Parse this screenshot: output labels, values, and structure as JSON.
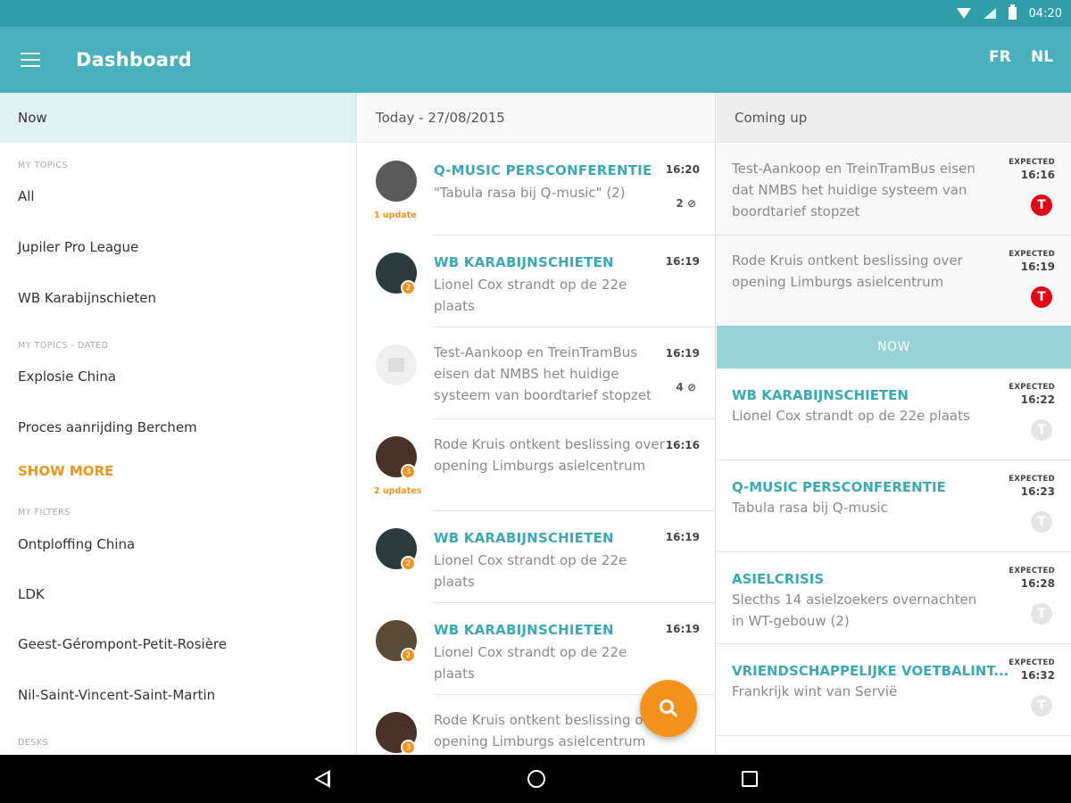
{
  "status_bar": {
    "time": "04:20"
  },
  "app_bar": {
    "title": "Dashboard",
    "lang_fr": "FR",
    "lang_nl": "NL"
  },
  "sidebar": {
    "now_label": "Now",
    "sections": {
      "my_topics": "MY TOPICS",
      "my_topics_dated": "MY TOPICS - DATED",
      "my_filters": "MY FILTERS",
      "desks": "DESKS"
    },
    "topics": [
      "All",
      "Jupiler Pro League",
      "WB Karabijnschieten"
    ],
    "dated_topics": [
      "Explosie China",
      "Proces aanrijding Berchem"
    ],
    "show_more": "SHOW MORE",
    "filters": [
      "Ontploffing China",
      "LDK",
      "Geest-Gérompont-Petit-Rosière",
      "Nil-Saint-Vincent-Saint-Martin"
    ]
  },
  "feed": {
    "header": "Today - 27/08/2015",
    "items": [
      {
        "title": "Q-MUSIC PERSCONFERENTIE",
        "text": "\"Tabula rasa bij Q-music\" (2)",
        "time": "16:20",
        "attach": "2",
        "updates": "1 update",
        "badge": "",
        "avatar_color": "#5a5a5a"
      },
      {
        "title": "WB KARABIJNSCHIETEN",
        "text": "Lionel Cox strandt op de 22e plaats",
        "time": "16:19",
        "attach": "",
        "updates": "",
        "badge": "2",
        "avatar_color": "#2b3a3c"
      },
      {
        "title": "",
        "text": "Test-Aankoop en TreinTramBus eisen dat NMBS het huidige systeem van boordtarief stopzet",
        "time": "16:19",
        "attach": "4",
        "updates": "",
        "badge": "",
        "avatar_color": ""
      },
      {
        "title": "",
        "text": "Rode Kruis ontkent beslissing over opening Limburgs asielcentrum",
        "time": "16:16",
        "attach": "",
        "updates": "2 updates",
        "badge": "3",
        "avatar_color": "#4a3229"
      },
      {
        "title": "WB KARABIJNSCHIETEN",
        "text": "Lionel Cox strandt op de 22e plaats",
        "time": "16:19",
        "attach": "",
        "updates": "",
        "badge": "2",
        "avatar_color": "#2b3a3c"
      },
      {
        "title": "WB KARABIJNSCHIETEN",
        "text": "Lionel Cox strandt op de 22e plaats",
        "time": "16:19",
        "attach": "",
        "updates": "",
        "badge": "2",
        "avatar_color": "#5b4a36"
      },
      {
        "title": "",
        "text": "Rode Kruis ontkent beslissing over opening Limburgs asielcentrum",
        "time": "",
        "attach": "",
        "updates": "",
        "badge": "3",
        "avatar_color": "#4a3229"
      }
    ]
  },
  "coming_up": {
    "header": "Coming up",
    "now_label": "NOW",
    "expected_label": "EXPECTED",
    "past": [
      {
        "title": "",
        "text": "Test-Aankoop en TreinTramBus eisen dat NMBS het huidige systeem van boordtarief stopzet",
        "time": "16:16",
        "icon": "T"
      },
      {
        "title": "",
        "text": "Rode Kruis ontkent beslissing over opening Limburgs asielcentrum",
        "time": "16:19",
        "icon": "T"
      }
    ],
    "future": [
      {
        "title": "WB KARABIJNSCHIETEN",
        "text": "Lionel Cox strandt op de 22e plaats",
        "time": "16:22",
        "icon": "T"
      },
      {
        "title": "Q-MUSIC PERSCONFERENTIE",
        "text": "Tabula rasa bij Q-music",
        "time": "16:23",
        "icon": "T"
      },
      {
        "title": "ASIELCRISIS",
        "text": "Slecths 14 asielzoekers overnachten in WT-gebouw (2)",
        "time": "16:28",
        "icon": "T"
      },
      {
        "title": "VRIENDSCHAPPELIJKE VOETBALINT...",
        "text": "Frankrijk wint van Servië",
        "time": "16:32",
        "icon": "T"
      }
    ]
  },
  "colors": {
    "primary": "#48b1bc",
    "accent": "#f3931e",
    "teal_text": "#3ba9b5",
    "transit_red": "#e30613"
  }
}
